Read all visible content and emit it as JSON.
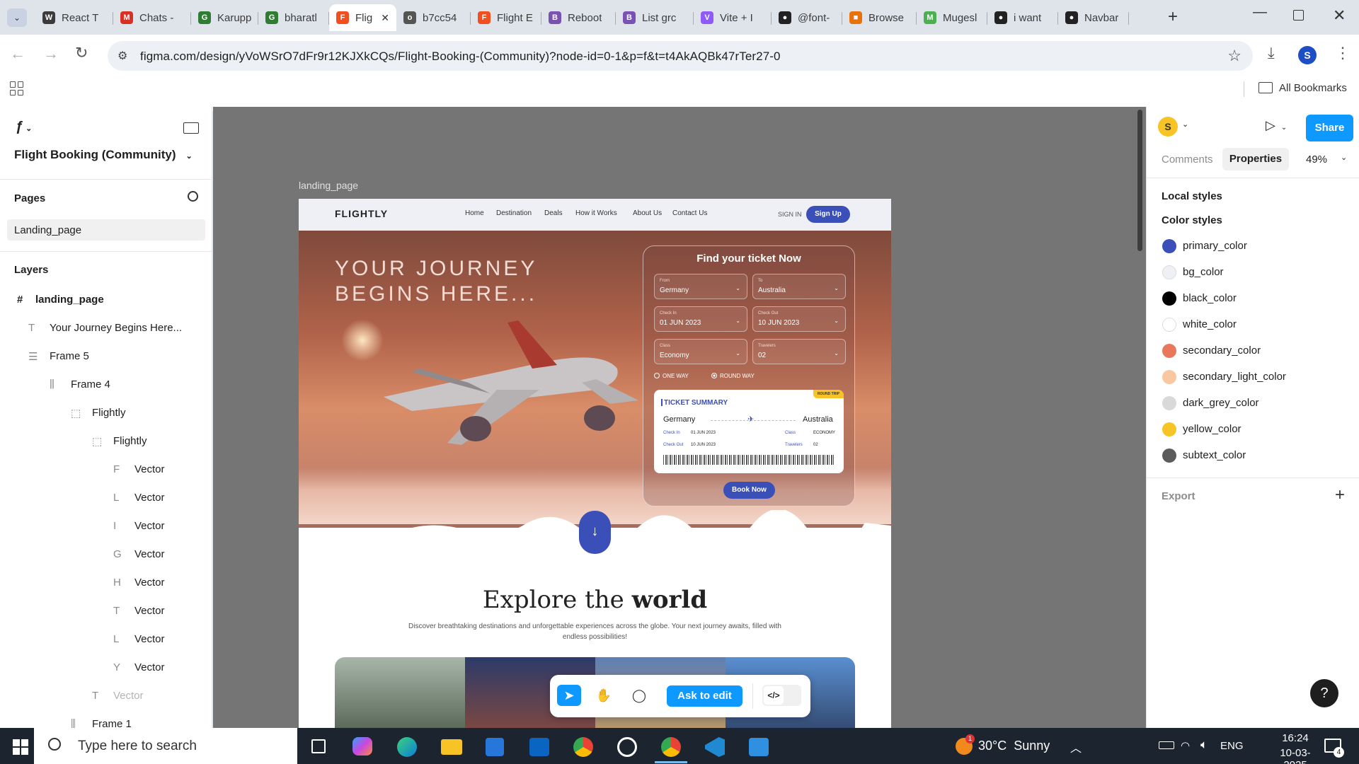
{
  "browser": {
    "tabs": [
      {
        "label": "React T",
        "favicon": "W",
        "color": "#3b3b3b"
      },
      {
        "label": "Chats -",
        "favicon": "M",
        "color": "#d93025"
      },
      {
        "label": "Karupp",
        "favicon": "G",
        "color": "#2f7d32"
      },
      {
        "label": "bharatl",
        "favicon": "G",
        "color": "#2f7d32"
      },
      {
        "label": "Flig",
        "favicon": "F",
        "color": "#f24e1e",
        "active": true
      },
      {
        "label": "b7cc54",
        "favicon": "o",
        "color": "#555555"
      },
      {
        "label": "Flight E",
        "favicon": "F",
        "color": "#f24e1e"
      },
      {
        "label": "Reboot",
        "favicon": "B",
        "color": "#7952b3"
      },
      {
        "label": "List grc",
        "favicon": "B",
        "color": "#7952b3"
      },
      {
        "label": "Vite + I",
        "favicon": "V",
        "color": "#8f5af8"
      },
      {
        "label": "@font-",
        "favicon": "●",
        "color": "#222222"
      },
      {
        "label": "Browse",
        "favicon": "■",
        "color": "#e8710a"
      },
      {
        "label": "Mugesl",
        "favicon": "M",
        "color": "#4caf50"
      },
      {
        "label": "i want",
        "favicon": "●",
        "color": "#222222"
      },
      {
        "label": "Navbar",
        "favicon": "●",
        "color": "#222222"
      }
    ],
    "url": "figma.com/design/yVoWSrO7dFr9r12KJXkCQs/Flight-Booking-(Community)?node-id=0-1&p=f&t=t4AkAQBk47rTer27-0",
    "bookmarks_label": "All Bookmarks",
    "profile_initial": "S"
  },
  "figma": {
    "file_name": "Flight Booking (Community)",
    "pages_heading": "Pages",
    "current_page": "Landing_page",
    "layers_heading": "Layers",
    "layers": [
      {
        "name": "landing_page",
        "icon": "#",
        "bold": true
      },
      {
        "name": "Your Journey Begins Here...",
        "icon": "T"
      },
      {
        "name": "Frame 5",
        "icon": "☰"
      },
      {
        "name": "Frame 4",
        "icon": "⫼"
      },
      {
        "name": "Flightly",
        "icon": "⬚"
      },
      {
        "name": "Flightly",
        "icon": "⬚"
      },
      {
        "name": "Vector",
        "icon": "F"
      },
      {
        "name": "Vector",
        "icon": "L"
      },
      {
        "name": "Vector",
        "icon": "I"
      },
      {
        "name": "Vector",
        "icon": "G"
      },
      {
        "name": "Vector",
        "icon": "H"
      },
      {
        "name": "Vector",
        "icon": "T"
      },
      {
        "name": "Vector",
        "icon": "L"
      },
      {
        "name": "Vector",
        "icon": "Y"
      },
      {
        "name": "Vector",
        "icon": "T",
        "dim": true
      },
      {
        "name": "Frame 1",
        "icon": "⫼"
      }
    ],
    "right_panel": {
      "tab_comments": "Comments",
      "tab_properties": "Properties",
      "zoom": "49%",
      "share": "Share",
      "avatar": "S",
      "local_styles": "Local styles",
      "color_styles_heading": "Color styles",
      "color_styles": [
        {
          "name": "primary_color",
          "color": "#3b4fb8"
        },
        {
          "name": "bg_color",
          "color": "#eef0f5"
        },
        {
          "name": "black_color",
          "color": "#000000"
        },
        {
          "name": "white_color",
          "color": "#ffffff"
        },
        {
          "name": "secondary_color",
          "color": "#e8775c"
        },
        {
          "name": "secondary_light_color",
          "color": "#f9c7a0"
        },
        {
          "name": "dark_grey_color",
          "color": "#d9d9d9"
        },
        {
          "name": "yellow_color",
          "color": "#f7c325"
        },
        {
          "name": "subtext_color",
          "color": "#5c5c5c"
        }
      ],
      "export_label": "Export"
    },
    "frame_label": "landing_page",
    "bottom_toolbar": {
      "ask_to_edit": "Ask to edit"
    }
  },
  "design": {
    "logo": "FLIGHTLY",
    "nav": [
      "Home",
      "Destination",
      "Deals",
      "How it Works",
      "About Us",
      "Contact Us"
    ],
    "sign_in": "SIGN IN",
    "sign_up": "Sign Up",
    "hero_line1": "YOUR JOURNEY",
    "hero_line2": "BEGINS HERE...",
    "form": {
      "title": "Find your ticket Now",
      "fields": [
        {
          "key": "From",
          "value": "Germany"
        },
        {
          "key": "To",
          "value": "Australia"
        },
        {
          "key": "Check In",
          "value": "01 JUN 2023"
        },
        {
          "key": "Check Out",
          "value": "10 JUN 2023"
        },
        {
          "key": "Class",
          "value": "Economy"
        },
        {
          "key": "Travelers",
          "value": "02"
        }
      ],
      "one_way": "ONE WAY",
      "round_trip": "ROUND WAY"
    },
    "ticket": {
      "badge": "ROUND TRIP",
      "title": "TICKET SUMMARY",
      "from": "Germany",
      "to": "Australia",
      "check_in_label": "Check In",
      "check_in": "01 JUN 2023",
      "check_out_label": "Check Out",
      "check_out": "10 JUN 2023",
      "class_label": "Class",
      "class": "ECONOMY",
      "travelers_label": "Travelers",
      "travelers": "02"
    },
    "book_now": "Book Now",
    "explore_light": "Explore the",
    "explore_bold": "world",
    "explore_sub1": "Discover breathtaking destinations and unforgettable experiences across the globe. Your next journey awaits, filled with",
    "explore_sub2": "endless possibilities!"
  },
  "taskbar": {
    "search_placeholder": "Type here to search",
    "weather": "30°C  Sunny",
    "weather_badge": "1",
    "lang": "ENG",
    "time": "16:24",
    "date": "10-03-2025",
    "notif_count": "4"
  }
}
